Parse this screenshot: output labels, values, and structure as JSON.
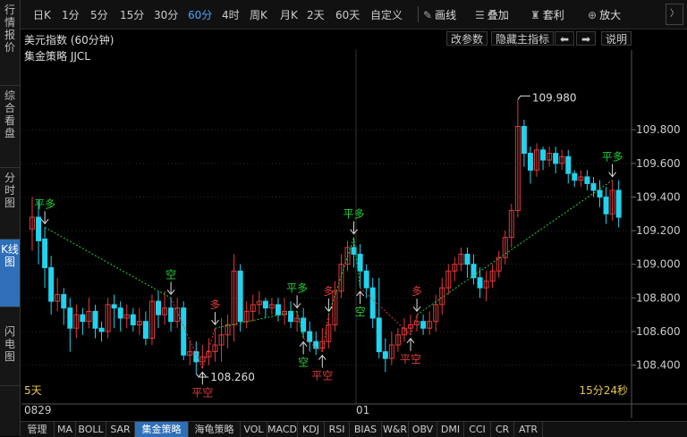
{
  "sidebar": {
    "tabs": [
      {
        "label": "行情报价",
        "active": false
      },
      {
        "label": "综合看盘",
        "active": false
      },
      {
        "label": "分时图",
        "active": false
      },
      {
        "label": "K线图",
        "active": true
      },
      {
        "label": "闪电图",
        "active": false
      }
    ]
  },
  "toolbar": {
    "periods": [
      "日K",
      "1分",
      "5分",
      "15分",
      "30分",
      "60分",
      "4时",
      "周K",
      "月K",
      "2天",
      "60天",
      "自定义"
    ],
    "active_period": "60分",
    "tools": [
      {
        "label": "画线",
        "icon": "pencil-icon"
      },
      {
        "label": "叠加",
        "icon": "layers-icon"
      },
      {
        "label": "套利",
        "icon": "bag-icon"
      },
      {
        "label": "放大",
        "icon": "magnify-icon"
      }
    ]
  },
  "infobar": {
    "title": "美元指数 (60分钟)",
    "buttons": [
      "改参数",
      "隐藏主指标",
      "⬅",
      "➡",
      "说明"
    ]
  },
  "indicator": {
    "name": "集金策略 JJCL"
  },
  "chart_data": {
    "type": "candlestick",
    "y_ticks": [
      "109.800",
      "109.600",
      "109.400",
      "109.200",
      "109.000",
      "108.800",
      "108.600",
      "108.400"
    ],
    "ylim": [
      108.18,
      110.2
    ],
    "x_ticks": [
      "0829",
      "01"
    ],
    "bottom_left_label": "5天",
    "bottom_right_label": "15分24秒",
    "high_label": "109.980",
    "low_label": "108.260",
    "colors": {
      "up": "#e03a3a",
      "down": "#22d3ee",
      "buy": "#e03a3a",
      "sell": "#22d03a"
    },
    "candles": [
      [
        109.21,
        109.28,
        109.08,
        109.4
      ],
      [
        109.28,
        109.14,
        109.0,
        109.38
      ],
      [
        109.15,
        108.98,
        108.86,
        109.22
      ],
      [
        108.98,
        108.78,
        108.7,
        109.05
      ],
      [
        108.78,
        108.82,
        108.72,
        108.92
      ],
      [
        108.82,
        108.74,
        108.64,
        108.86
      ],
      [
        108.74,
        108.62,
        108.48,
        108.8
      ],
      [
        108.62,
        108.7,
        108.56,
        108.76
      ],
      [
        108.7,
        108.66,
        108.58,
        108.74
      ],
      [
        108.66,
        108.72,
        108.62,
        108.8
      ],
      [
        108.72,
        108.62,
        108.56,
        108.76
      ],
      [
        108.62,
        108.6,
        108.54,
        108.66
      ],
      [
        108.6,
        108.76,
        108.56,
        108.8
      ],
      [
        108.76,
        108.74,
        108.62,
        108.82
      ],
      [
        108.74,
        108.68,
        108.6,
        108.78
      ],
      [
        108.68,
        108.7,
        108.62,
        108.76
      ],
      [
        108.7,
        108.64,
        108.6,
        108.74
      ],
      [
        108.64,
        108.66,
        108.58,
        108.74
      ],
      [
        108.66,
        108.56,
        108.52,
        108.72
      ],
      [
        108.56,
        108.78,
        108.52,
        108.82
      ],
      [
        108.78,
        108.7,
        108.62,
        108.84
      ],
      [
        108.7,
        108.74,
        108.64,
        108.84
      ],
      [
        108.74,
        108.66,
        108.6,
        108.8
      ],
      [
        108.66,
        108.74,
        108.62,
        108.8
      ],
      [
        108.74,
        108.46,
        108.43,
        108.78
      ],
      [
        108.46,
        108.48,
        108.4,
        108.54
      ],
      [
        108.48,
        108.42,
        108.35,
        108.54
      ],
      [
        108.42,
        108.45,
        108.38,
        108.52
      ],
      [
        108.45,
        108.48,
        108.4,
        108.56
      ],
      [
        108.48,
        108.52,
        108.42,
        108.62
      ],
      [
        108.52,
        108.58,
        108.42,
        108.68
      ],
      [
        108.58,
        108.64,
        108.5,
        108.7
      ],
      [
        108.64,
        108.96,
        108.54,
        109.06
      ],
      [
        108.96,
        108.66,
        108.6,
        109.0
      ],
      [
        108.66,
        108.72,
        108.62,
        108.78
      ],
      [
        108.72,
        108.76,
        108.66,
        108.82
      ],
      [
        108.76,
        108.78,
        108.7,
        108.84
      ],
      [
        108.78,
        108.74,
        108.68,
        108.8
      ],
      [
        108.74,
        108.76,
        108.7,
        108.8
      ],
      [
        108.76,
        108.7,
        108.66,
        108.8
      ],
      [
        108.7,
        108.72,
        108.64,
        108.8
      ],
      [
        108.72,
        108.66,
        108.62,
        108.78
      ],
      [
        108.66,
        108.68,
        108.6,
        108.72
      ],
      [
        108.68,
        108.6,
        108.56,
        108.74
      ],
      [
        108.6,
        108.54,
        108.48,
        108.66
      ],
      [
        108.54,
        108.5,
        108.46,
        108.6
      ],
      [
        108.5,
        108.54,
        108.48,
        108.62
      ],
      [
        108.54,
        108.64,
        108.5,
        108.7
      ],
      [
        108.64,
        108.84,
        108.6,
        108.9
      ],
      [
        108.84,
        109.0,
        108.8,
        109.06
      ],
      [
        109.0,
        109.1,
        108.96,
        109.14
      ],
      [
        109.1,
        109.06,
        108.98,
        109.16
      ],
      [
        109.06,
        108.96,
        108.86,
        109.12
      ],
      [
        108.96,
        108.86,
        108.8,
        109.0
      ],
      [
        108.86,
        108.68,
        108.62,
        108.92
      ],
      [
        108.68,
        108.48,
        108.44,
        108.92
      ],
      [
        108.48,
        108.44,
        108.36,
        108.56
      ],
      [
        108.44,
        108.52,
        108.4,
        108.6
      ],
      [
        108.52,
        108.58,
        108.48,
        108.62
      ],
      [
        108.58,
        108.62,
        108.54,
        108.68
      ],
      [
        108.62,
        108.64,
        108.58,
        108.7
      ],
      [
        108.64,
        108.66,
        108.6,
        108.7
      ],
      [
        108.66,
        108.62,
        108.58,
        108.7
      ],
      [
        108.62,
        108.66,
        108.58,
        108.72
      ],
      [
        108.66,
        108.76,
        108.6,
        108.82
      ],
      [
        108.76,
        108.86,
        108.7,
        108.92
      ],
      [
        108.86,
        108.96,
        108.82,
        109.0
      ],
      [
        108.96,
        109.0,
        108.9,
        109.04
      ],
      [
        109.0,
        109.06,
        108.96,
        109.1
      ],
      [
        109.06,
        109.0,
        108.92,
        109.1
      ],
      [
        109.0,
        108.92,
        108.88,
        109.06
      ],
      [
        108.92,
        108.86,
        108.8,
        108.98
      ],
      [
        108.86,
        108.9,
        108.78,
        108.96
      ],
      [
        108.9,
        108.96,
        108.86,
        109.0
      ],
      [
        108.96,
        109.04,
        108.92,
        109.08
      ],
      [
        109.04,
        109.16,
        109.0,
        109.2
      ],
      [
        109.16,
        109.32,
        109.1,
        109.36
      ],
      [
        109.32,
        109.82,
        109.28,
        109.98
      ],
      [
        109.82,
        109.66,
        109.58,
        109.86
      ],
      [
        109.66,
        109.56,
        109.48,
        109.7
      ],
      [
        109.56,
        109.68,
        109.52,
        109.72
      ],
      [
        109.68,
        109.62,
        109.56,
        109.7
      ],
      [
        109.62,
        109.66,
        109.58,
        109.7
      ],
      [
        109.66,
        109.6,
        109.54,
        109.7
      ],
      [
        109.6,
        109.64,
        109.56,
        109.68
      ],
      [
        109.64,
        109.54,
        109.48,
        109.68
      ],
      [
        109.54,
        109.5,
        109.46,
        109.56
      ],
      [
        109.5,
        109.52,
        109.46,
        109.56
      ],
      [
        109.52,
        109.48,
        109.44,
        109.56
      ],
      [
        109.48,
        109.44,
        109.4,
        109.52
      ],
      [
        109.44,
        109.4,
        109.34,
        109.5
      ],
      [
        109.4,
        109.3,
        109.24,
        109.46
      ],
      [
        109.3,
        109.44,
        109.26,
        109.5
      ],
      [
        109.44,
        109.28,
        109.22,
        109.5
      ]
    ],
    "signals": [
      {
        "candle": 2,
        "label": "平多",
        "pos": "above",
        "color": "sell"
      },
      {
        "candle": 22,
        "label": "空",
        "pos": "above",
        "color": "sell"
      },
      {
        "candle": 27,
        "label": "平空",
        "pos": "below",
        "color": "buy"
      },
      {
        "candle": 29,
        "label": "多",
        "pos": "above",
        "color": "buy"
      },
      {
        "candle": 42,
        "label": "平多",
        "pos": "above",
        "color": "sell"
      },
      {
        "candle": 43,
        "label": "空",
        "pos": "below",
        "color": "sell"
      },
      {
        "candle": 46,
        "label": "平空",
        "pos": "below",
        "color": "buy"
      },
      {
        "candle": 47,
        "label": "多",
        "pos": "above",
        "color": "buy"
      },
      {
        "candle": 51,
        "label": "平多",
        "pos": "above",
        "color": "sell"
      },
      {
        "candle": 52,
        "label": "空",
        "pos": "below",
        "color": "sell"
      },
      {
        "candle": 60,
        "label": "平空",
        "pos": "below",
        "color": "buy"
      },
      {
        "candle": 61,
        "label": "多",
        "pos": "above",
        "color": "buy"
      },
      {
        "candle": 92,
        "label": "平多",
        "pos": "above",
        "color": "sell"
      }
    ]
  },
  "bottom_tabs": {
    "items": [
      "管理",
      "MA",
      "BOLL",
      "SAR",
      "集金策略",
      "海龟策略",
      "VOL",
      "MACD",
      "KDJ",
      "RSI",
      "BIAS",
      "W&R",
      "OBV",
      "DMI",
      "CCI",
      "CR",
      "ATR"
    ],
    "active": "集金策略"
  }
}
